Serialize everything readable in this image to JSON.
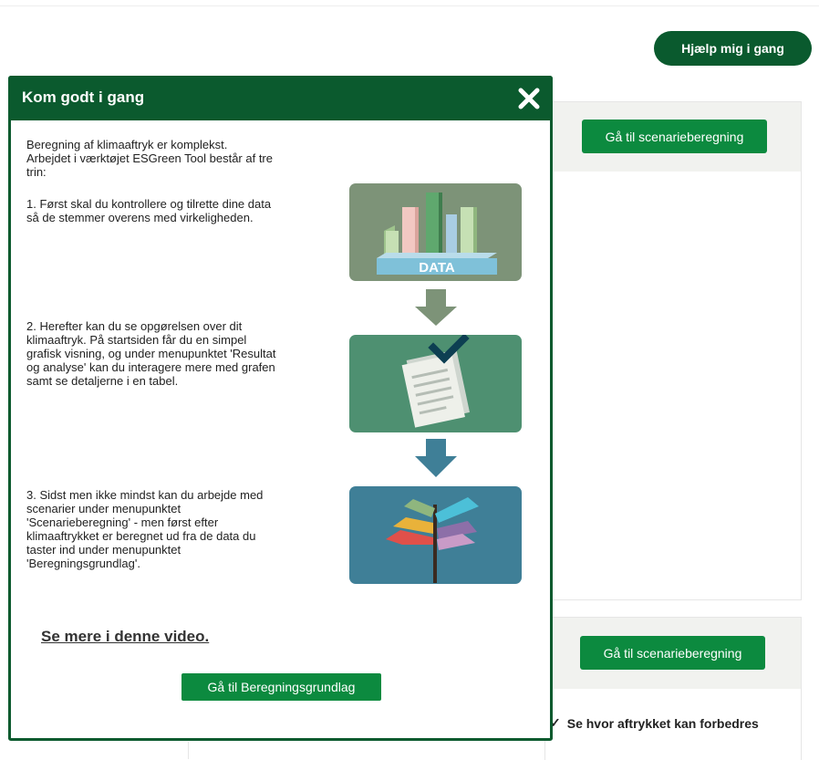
{
  "header": {
    "help_label": "Hjælp mig i gang"
  },
  "cards": [
    {
      "button_label": "Gå til scenarieberegning"
    },
    {
      "button_label": "Gå til scenarieberegning"
    }
  ],
  "improve_link": "Se hvor aftrykket kan forbedres",
  "modal": {
    "title": "Kom godt i gang",
    "intro_line1": "Beregning af klimaaftryk er komplekst.",
    "intro_line2": "Arbejdet i værktøjet ESGreen Tool består af tre",
    "intro_line3": "trin:",
    "step1_line1": "1. Først skal du kontrollere og tilrette dine data",
    "step1_line2": "så de stemmer overens med virkeligheden.",
    "step2_line1": "2. Herefter kan du se opgørelsen over dit",
    "step2_line2": "klimaaftryk. På startsiden får du en simpel",
    "step2_line3": "grafisk visning, og under menupunktet 'Resultat",
    "step2_line4": "og analyse' kan du interagere mere med grafen",
    "step2_line5": "samt se detaljerne i en tabel.",
    "step3_line1": "3. Sidst men ikke mindst kan du arbejde med",
    "step3_line2": "scenarier under menupunktet",
    "step3_line3": "'Scenarieberegning' - men først efter",
    "step3_line4": "klimaaftrykket er beregnet ud fra de data du",
    "step3_line5": "taster ind under menupunktet",
    "step3_line6": "'Beregningsgrundlag'.",
    "data_label": "DATA",
    "video_link": "Se mere i denne video.",
    "primary_button": "Gå til Beregningsgrundlag"
  },
  "colors": {
    "dark_green": "#0b5a2e",
    "button_green": "#0c8a3f",
    "illus1_bg": "#7d9378",
    "illus2_bg": "#4e9071",
    "illus3_bg": "#3f7f97"
  },
  "icons": {
    "close": "close-icon",
    "check": "check-icon",
    "arrow": "arrow-down-icon",
    "data_chart": "data-chart-illustration",
    "documents": "documents-checkmark-illustration",
    "signpost": "signpost-illustration"
  }
}
